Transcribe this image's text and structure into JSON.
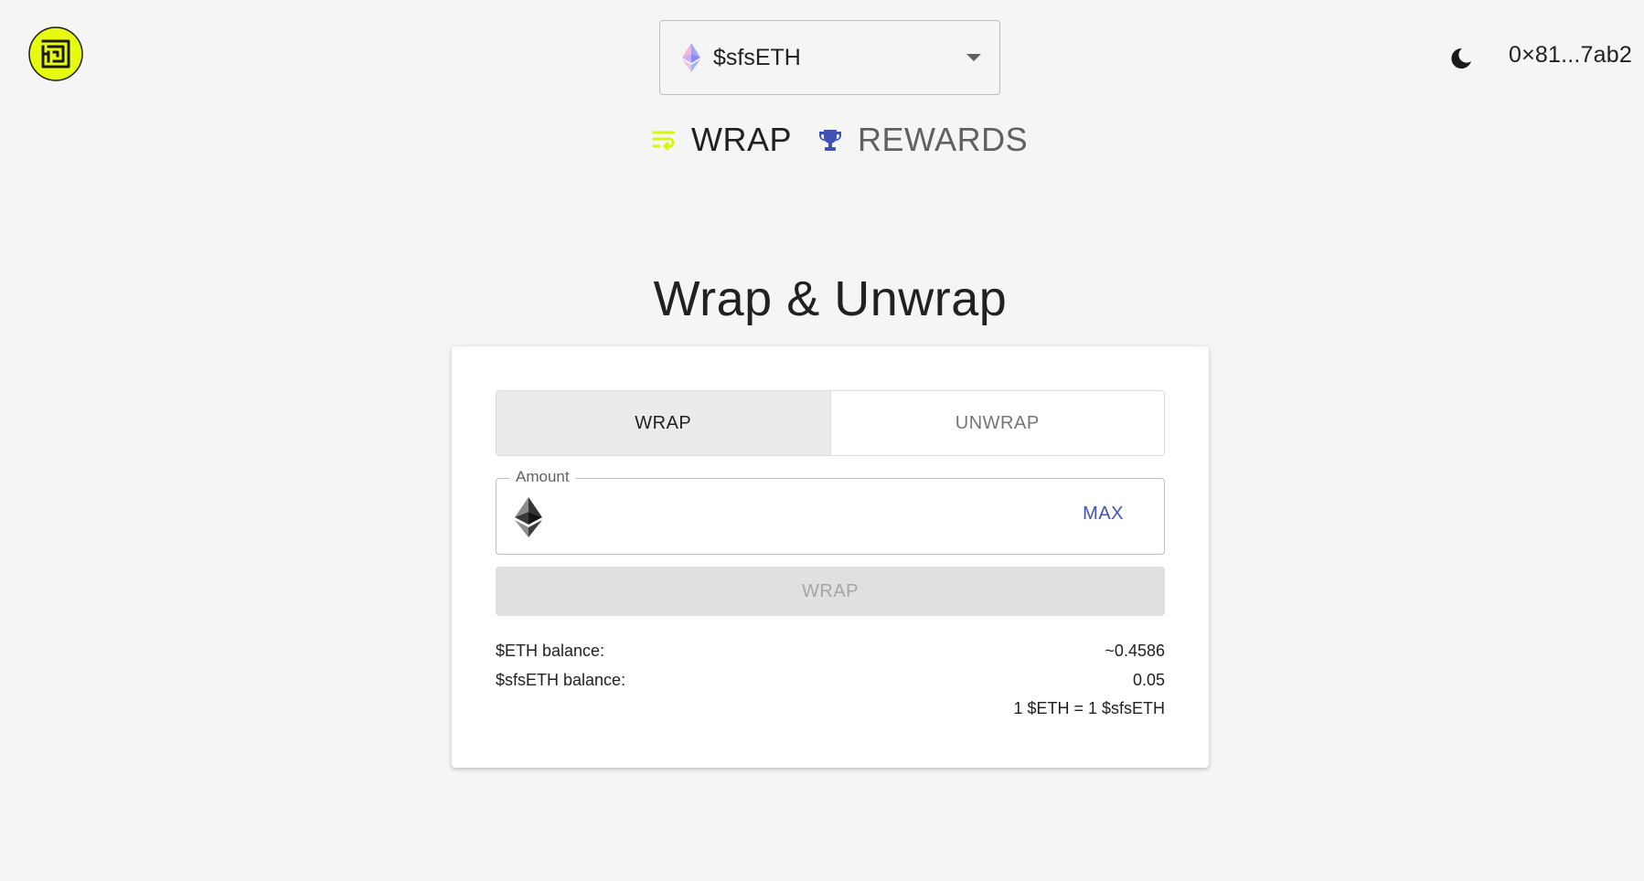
{
  "header": {
    "token_select": {
      "selected": "$sfsETH",
      "icon": "ethereum-color-icon"
    },
    "theme_toggle_icon": "moon-icon",
    "wallet_address": "0×81...7ab2"
  },
  "nav": {
    "items": [
      {
        "label": "WRAP",
        "icon": "wrap-lines-icon",
        "active": true
      },
      {
        "label": "REWARDS",
        "icon": "trophy-icon",
        "active": false
      }
    ]
  },
  "main": {
    "heading": "Wrap & Unwrap",
    "card": {
      "mode_toggle": [
        {
          "label": "WRAP",
          "active": true
        },
        {
          "label": "UNWRAP",
          "active": false
        }
      ],
      "amount": {
        "label": "Amount",
        "value": "",
        "max_label": "MAX",
        "icon": "ethereum-icon"
      },
      "submit_label": "WRAP",
      "balances": [
        {
          "label": "$ETH balance:",
          "value": "~0.4586"
        },
        {
          "label": "$sfsETH balance:",
          "value": "0.05"
        }
      ],
      "rate": "1 $ETH = 1 $sfsETH"
    }
  },
  "colors": {
    "logo_fill": "#e6fb0e",
    "accent": "#3f51b5",
    "background": "#f5f5f5",
    "wrap_icon": "#d7f50b"
  }
}
